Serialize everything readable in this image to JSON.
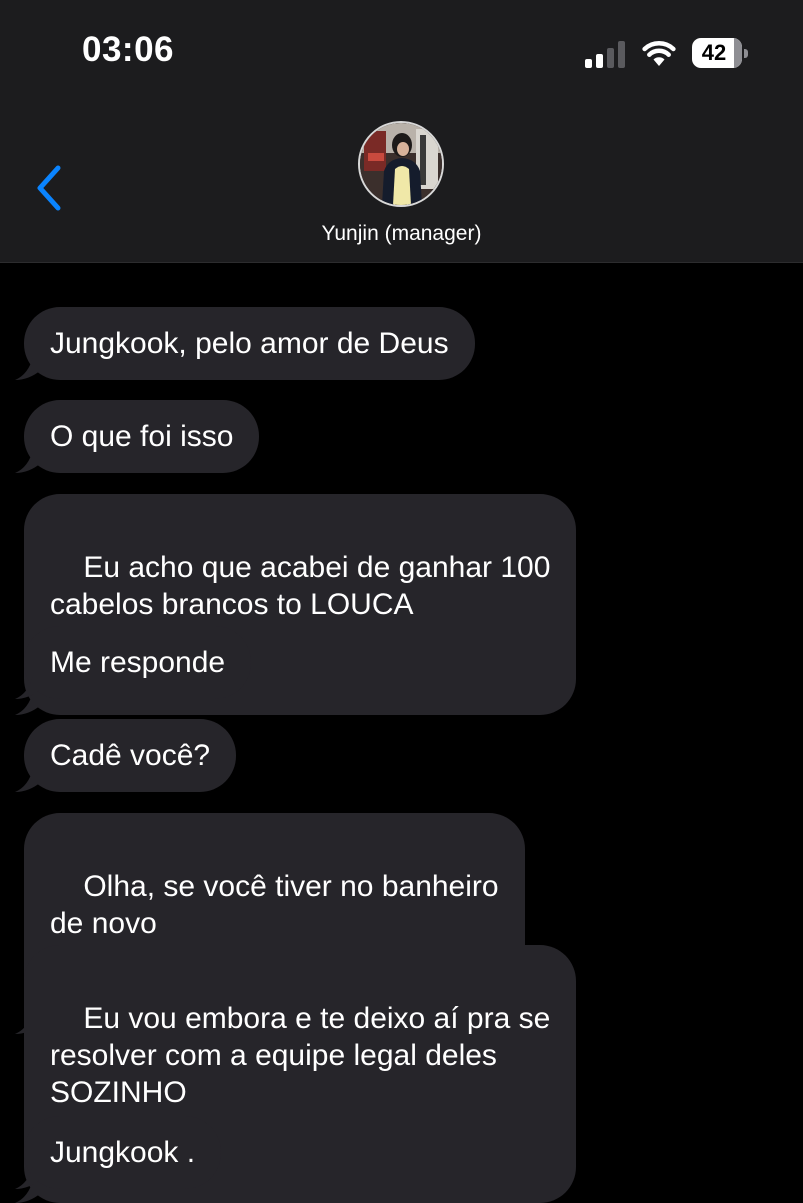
{
  "status_bar": {
    "time": "03:06",
    "battery_level": "42",
    "signal_bars_active": 2,
    "signal_bars_total": 4
  },
  "header": {
    "back_icon": "chevron-left-icon",
    "contact_name": "Yunjin (manager)",
    "avatar_icon": "contact-photo"
  },
  "messages": [
    {
      "text": "Jungkook, pelo amor de Deus"
    },
    {
      "text": "O que foi isso"
    },
    {
      "text": "Eu acho que acabei de ganhar 100\ncabelos brancos to LOUCA"
    },
    {
      "text": "Me responde"
    },
    {
      "text": "Cadê você?"
    },
    {
      "text": "Olha, se você tiver no banheiro\nde novo"
    },
    {
      "text": "Eu vou embora e te deixo aí pra se\nresolver com a equipe legal deles\nSOZINHO"
    },
    {
      "text": "Jungkook ."
    }
  ],
  "colors": {
    "background": "#000000",
    "header_background": "#1c1c1e",
    "bubble_incoming": "#26252a",
    "accent": "#0a84ff"
  }
}
